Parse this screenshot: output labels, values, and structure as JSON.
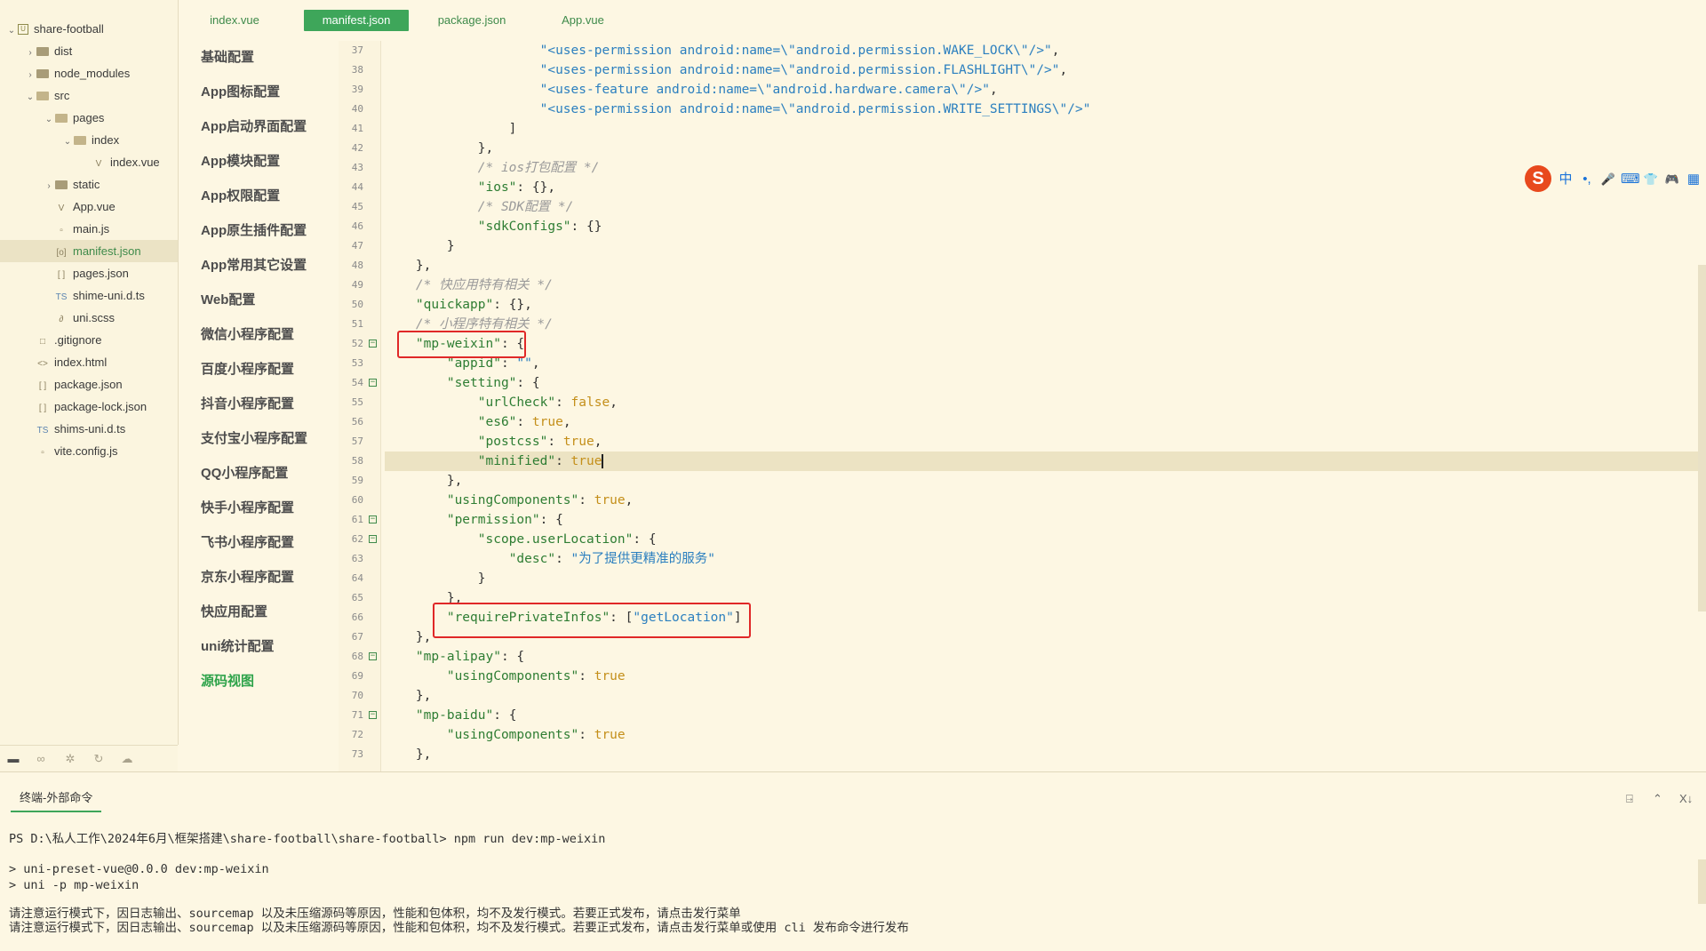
{
  "explorer": {
    "items": [
      {
        "label": "share-football",
        "depth": 0,
        "chev": "open",
        "icon": "root"
      },
      {
        "label": "dist",
        "depth": 1,
        "chev": "closed",
        "icon": "folder"
      },
      {
        "label": "node_modules",
        "depth": 1,
        "chev": "closed",
        "icon": "folder"
      },
      {
        "label": "src",
        "depth": 1,
        "chev": "open",
        "icon": "folder-open"
      },
      {
        "label": "pages",
        "depth": 2,
        "chev": "open",
        "icon": "folder-open"
      },
      {
        "label": "index",
        "depth": 3,
        "chev": "open",
        "icon": "folder-open"
      },
      {
        "label": "index.vue",
        "depth": 4,
        "chev": "",
        "icon": "vue"
      },
      {
        "label": "static",
        "depth": 2,
        "chev": "closed",
        "icon": "folder"
      },
      {
        "label": "App.vue",
        "depth": 2,
        "chev": "",
        "icon": "vue"
      },
      {
        "label": "main.js",
        "depth": 2,
        "chev": "",
        "icon": "js"
      },
      {
        "label": "manifest.json",
        "depth": 2,
        "chev": "",
        "icon": "manifest",
        "selected": true
      },
      {
        "label": "pages.json",
        "depth": 2,
        "chev": "",
        "icon": "json"
      },
      {
        "label": "shime-uni.d.ts",
        "depth": 2,
        "chev": "",
        "icon": "ts"
      },
      {
        "label": "uni.scss",
        "depth": 2,
        "chev": "",
        "icon": "scss"
      },
      {
        "label": ".gitignore",
        "depth": 1,
        "chev": "",
        "icon": "file"
      },
      {
        "label": "index.html",
        "depth": 1,
        "chev": "",
        "icon": "html"
      },
      {
        "label": "package.json",
        "depth": 1,
        "chev": "",
        "icon": "json"
      },
      {
        "label": "package-lock.json",
        "depth": 1,
        "chev": "",
        "icon": "json"
      },
      {
        "label": "shims-uni.d.ts",
        "depth": 1,
        "chev": "",
        "icon": "ts"
      },
      {
        "label": "vite.config.js",
        "depth": 1,
        "chev": "",
        "icon": "js"
      }
    ],
    "icon_glyphs": {
      "vue": "V",
      "js": "▫",
      "manifest": "[o]",
      "json": "[ ]",
      "ts": "TS",
      "scss": "∂",
      "file": "□",
      "html": "<>",
      "root": "U"
    },
    "bottom_icons": [
      "files-icon",
      "binoculars-icon",
      "debug-icon",
      "refresh-icon",
      "cloud-icon"
    ]
  },
  "tabs": [
    {
      "label": "index.vue",
      "active": false
    },
    {
      "label": "manifest.json",
      "active": true
    },
    {
      "label": "package.json",
      "active": false
    },
    {
      "label": "App.vue",
      "active": false
    }
  ],
  "config_nav": [
    {
      "label": "基础配置"
    },
    {
      "label": "App图标配置"
    },
    {
      "label": "App启动界面配置"
    },
    {
      "label": "App模块配置"
    },
    {
      "label": "App权限配置"
    },
    {
      "label": "App原生插件配置"
    },
    {
      "label": "App常用其它设置"
    },
    {
      "label": "Web配置"
    },
    {
      "label": "微信小程序配置"
    },
    {
      "label": "百度小程序配置"
    },
    {
      "label": "抖音小程序配置"
    },
    {
      "label": "支付宝小程序配置"
    },
    {
      "label": "QQ小程序配置"
    },
    {
      "label": "快手小程序配置"
    },
    {
      "label": "飞书小程序配置"
    },
    {
      "label": "京东小程序配置"
    },
    {
      "label": "快应用配置"
    },
    {
      "label": "uni统计配置"
    },
    {
      "label": "源码视图",
      "active": true
    }
  ],
  "code": {
    "lines": [
      {
        "n": "37",
        "fold": false,
        "tokens": [
          [
            "p",
            "                    "
          ],
          [
            "s",
            "\"<uses-permission android:name=\\\"android.permission.WAKE_LOCK\\\"/>\""
          ],
          [
            "p",
            ","
          ]
        ]
      },
      {
        "n": "38",
        "fold": false,
        "tokens": [
          [
            "p",
            "                    "
          ],
          [
            "s",
            "\"<uses-permission android:name=\\\"android.permission.FLASHLIGHT\\\"/>\""
          ],
          [
            "p",
            ","
          ]
        ]
      },
      {
        "n": "39",
        "fold": false,
        "tokens": [
          [
            "p",
            "                    "
          ],
          [
            "s",
            "\"<uses-feature android:name=\\\"android.hardware.camera\\\"/>\""
          ],
          [
            "p",
            ","
          ]
        ]
      },
      {
        "n": "40",
        "fold": false,
        "tokens": [
          [
            "p",
            "                    "
          ],
          [
            "s",
            "\"<uses-permission android:name=\\\"android.permission.WRITE_SETTINGS\\\"/>\""
          ]
        ]
      },
      {
        "n": "41",
        "fold": false,
        "tokens": [
          [
            "p",
            "                ]"
          ]
        ]
      },
      {
        "n": "42",
        "fold": false,
        "tokens": [
          [
            "p",
            "            },"
          ]
        ]
      },
      {
        "n": "43",
        "fold": false,
        "tokens": [
          [
            "p",
            "            "
          ],
          [
            "c",
            "/* ios打包配置 */"
          ]
        ]
      },
      {
        "n": "44",
        "fold": false,
        "tokens": [
          [
            "p",
            "            "
          ],
          [
            "k",
            "\"ios\""
          ],
          [
            "p",
            ": {},"
          ]
        ]
      },
      {
        "n": "45",
        "fold": false,
        "tokens": [
          [
            "p",
            "            "
          ],
          [
            "c",
            "/* SDK配置 */"
          ]
        ]
      },
      {
        "n": "46",
        "fold": false,
        "tokens": [
          [
            "p",
            "            "
          ],
          [
            "k",
            "\"sdkConfigs\""
          ],
          [
            "p",
            ": {}"
          ]
        ]
      },
      {
        "n": "47",
        "fold": false,
        "tokens": [
          [
            "p",
            "        }"
          ]
        ]
      },
      {
        "n": "48",
        "fold": false,
        "tokens": [
          [
            "p",
            "    },"
          ]
        ]
      },
      {
        "n": "49",
        "fold": false,
        "tokens": [
          [
            "p",
            "    "
          ],
          [
            "c",
            "/* 快应用特有相关 */"
          ]
        ]
      },
      {
        "n": "50",
        "fold": false,
        "tokens": [
          [
            "p",
            "    "
          ],
          [
            "k",
            "\"quickapp\""
          ],
          [
            "p",
            ": {},"
          ]
        ]
      },
      {
        "n": "51",
        "fold": false,
        "tokens": [
          [
            "p",
            "    "
          ],
          [
            "c",
            "/* 小程序特有相关 */"
          ]
        ]
      },
      {
        "n": "52",
        "fold": true,
        "tokens": [
          [
            "p",
            "    "
          ],
          [
            "k",
            "\"mp-weixin\""
          ],
          [
            "p",
            ": {"
          ]
        ]
      },
      {
        "n": "53",
        "fold": false,
        "tokens": [
          [
            "p",
            "        "
          ],
          [
            "k",
            "\"appid\""
          ],
          [
            "p",
            ": "
          ],
          [
            "s",
            "\"\""
          ],
          [
            "p",
            ","
          ]
        ]
      },
      {
        "n": "54",
        "fold": true,
        "tokens": [
          [
            "p",
            "        "
          ],
          [
            "k",
            "\"setting\""
          ],
          [
            "p",
            ": {"
          ]
        ]
      },
      {
        "n": "55",
        "fold": false,
        "tokens": [
          [
            "p",
            "            "
          ],
          [
            "k",
            "\"urlCheck\""
          ],
          [
            "p",
            ": "
          ],
          [
            "b",
            "false"
          ],
          [
            "p",
            ","
          ]
        ]
      },
      {
        "n": "56",
        "fold": false,
        "tokens": [
          [
            "p",
            "            "
          ],
          [
            "k",
            "\"es6\""
          ],
          [
            "p",
            ": "
          ],
          [
            "b",
            "true"
          ],
          [
            "p",
            ","
          ]
        ]
      },
      {
        "n": "57",
        "fold": false,
        "tokens": [
          [
            "p",
            "            "
          ],
          [
            "k",
            "\"postcss\""
          ],
          [
            "p",
            ": "
          ],
          [
            "b",
            "true"
          ],
          [
            "p",
            ","
          ]
        ]
      },
      {
        "n": "58",
        "fold": false,
        "current": true,
        "tokens": [
          [
            "p",
            "            "
          ],
          [
            "k",
            "\"minified\""
          ],
          [
            "p",
            ": "
          ],
          [
            "b",
            "true"
          ]
        ]
      },
      {
        "n": "59",
        "fold": false,
        "tokens": [
          [
            "p",
            "        },"
          ]
        ]
      },
      {
        "n": "60",
        "fold": false,
        "tokens": [
          [
            "p",
            "        "
          ],
          [
            "k",
            "\"usingComponents\""
          ],
          [
            "p",
            ": "
          ],
          [
            "b",
            "true"
          ],
          [
            "p",
            ","
          ]
        ]
      },
      {
        "n": "61",
        "fold": true,
        "tokens": [
          [
            "p",
            "        "
          ],
          [
            "k",
            "\"permission\""
          ],
          [
            "p",
            ": {"
          ]
        ]
      },
      {
        "n": "62",
        "fold": true,
        "tokens": [
          [
            "p",
            "            "
          ],
          [
            "k",
            "\"scope.userLocation\""
          ],
          [
            "p",
            ": {"
          ]
        ]
      },
      {
        "n": "63",
        "fold": false,
        "tokens": [
          [
            "p",
            "                "
          ],
          [
            "k",
            "\"desc\""
          ],
          [
            "p",
            ": "
          ],
          [
            "s",
            "\"为了提供更精准的服务\""
          ]
        ]
      },
      {
        "n": "64",
        "fold": false,
        "tokens": [
          [
            "p",
            "            }"
          ]
        ]
      },
      {
        "n": "65",
        "fold": false,
        "tokens": [
          [
            "p",
            "        },"
          ]
        ]
      },
      {
        "n": "66",
        "fold": false,
        "tokens": [
          [
            "p",
            "        "
          ],
          [
            "k",
            "\"requirePrivateInfos\""
          ],
          [
            "p",
            ": ["
          ],
          [
            "s",
            "\"getLocation\""
          ],
          [
            "p",
            "]"
          ]
        ]
      },
      {
        "n": "67",
        "fold": false,
        "tokens": [
          [
            "p",
            "    },"
          ]
        ]
      },
      {
        "n": "68",
        "fold": true,
        "tokens": [
          [
            "p",
            "    "
          ],
          [
            "k",
            "\"mp-alipay\""
          ],
          [
            "p",
            ": {"
          ]
        ]
      },
      {
        "n": "69",
        "fold": false,
        "tokens": [
          [
            "p",
            "        "
          ],
          [
            "k",
            "\"usingComponents\""
          ],
          [
            "p",
            ": "
          ],
          [
            "b",
            "true"
          ]
        ]
      },
      {
        "n": "70",
        "fold": false,
        "tokens": [
          [
            "p",
            "    },"
          ]
        ]
      },
      {
        "n": "71",
        "fold": true,
        "tokens": [
          [
            "p",
            "    "
          ],
          [
            "k",
            "\"mp-baidu\""
          ],
          [
            "p",
            ": {"
          ]
        ]
      },
      {
        "n": "72",
        "fold": false,
        "tokens": [
          [
            "p",
            "        "
          ],
          [
            "k",
            "\"usingComponents\""
          ],
          [
            "p",
            ": "
          ],
          [
            "b",
            "true"
          ]
        ]
      },
      {
        "n": "73",
        "fold": false,
        "tokens": [
          [
            "p",
            "    },"
          ]
        ]
      }
    ],
    "fold_glyph": "−"
  },
  "ime_toolbar": {
    "logo": "S",
    "buttons": [
      {
        "label": "中",
        "name": "ime-chinese-button"
      },
      {
        "label": "•,",
        "name": "ime-punctuation-button"
      },
      {
        "label": "🎤",
        "name": "microphone-icon"
      },
      {
        "label": "⌨",
        "name": "keyboard-icon"
      },
      {
        "label": "👕",
        "name": "skin-icon"
      },
      {
        "label": "🎮",
        "name": "game-icon"
      },
      {
        "label": "▦",
        "name": "apps-grid-icon"
      }
    ]
  },
  "terminal": {
    "tab_label": "终端-外部命令",
    "controls": [
      "⍈",
      "⌃",
      "X↓"
    ],
    "lines": [
      {
        "text": "PS D:\\私人工作\\2024年6月\\框架搭建\\share-football\\share-football> npm run dev:mp-weixin"
      },
      {
        "text": ""
      },
      {
        "text": "> uni-preset-vue@0.0.0 dev:mp-weixin"
      },
      {
        "text": "> uni -p mp-weixin"
      },
      {
        "text": ""
      },
      {
        "text": "请注意运行模式下，因日志输出、sourcemap 以及未压缩源码等原因，性能和包体积，均不及发行模式。若要正式发布，请点击发行菜单"
      },
      {
        "text": "请注意运行模式下，因日志输出、sourcemap 以及未压缩源码等原因，性能和包体积，均不及发行模式。若要正式发布，请点击发行菜单或使用 cli 发布命令进行发布"
      }
    ]
  }
}
